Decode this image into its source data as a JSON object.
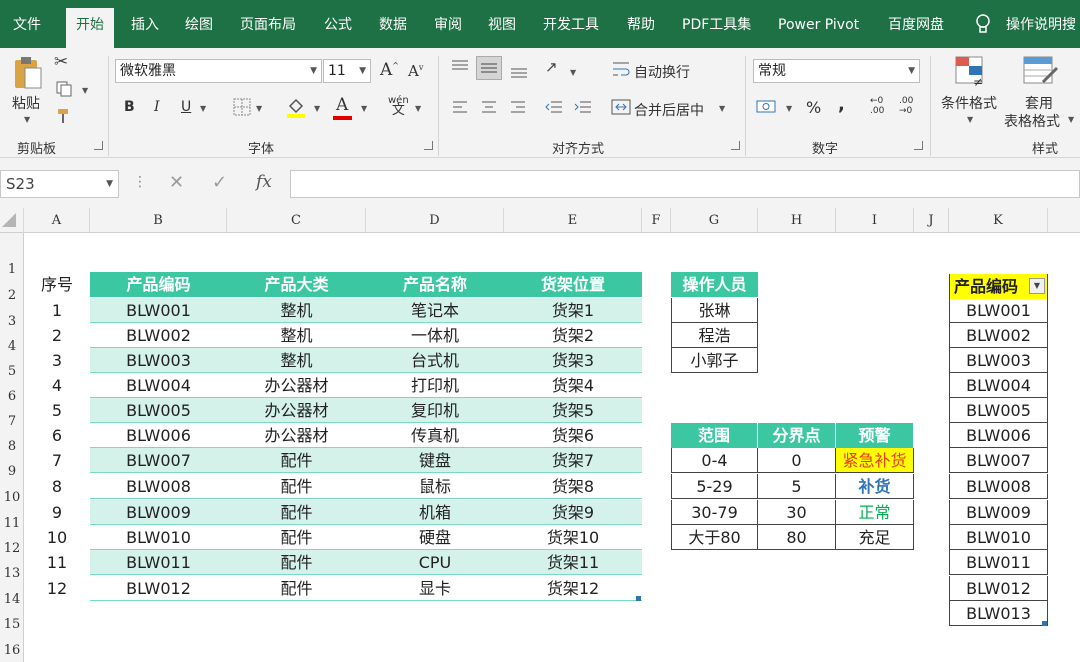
{
  "tabs": [
    "文件",
    "开始",
    "插入",
    "绘图",
    "页面布局",
    "公式",
    "数据",
    "审阅",
    "视图",
    "开发工具",
    "帮助",
    "PDF工具集",
    "Power Pivot",
    "百度网盘",
    "操作说明搜"
  ],
  "ribbon": {
    "paste_label": "粘贴",
    "clipboard_label": "剪贴板",
    "font_name": "微软雅黑",
    "font_size": "11",
    "font_label": "字体",
    "bold": "B",
    "italic": "I",
    "underline": "U",
    "wrap_text": "自动换行",
    "merge_center": "合并后居中",
    "align_label": "对齐方式",
    "number_format": "常规",
    "number_label": "数字",
    "cond_format": "条件格式",
    "table_format_1": "套用",
    "table_format_2": "表格格式",
    "style_label": "样式",
    "grow_font": "A",
    "shrink_font": "A",
    "font_color": "A",
    "percent": "%",
    "comma": ","
  },
  "formula_bar": {
    "name_box": "S23",
    "fx": "fx",
    "formula": ""
  },
  "columns": [
    "A",
    "B",
    "C",
    "D",
    "E",
    "F",
    "G",
    "H",
    "I",
    "J",
    "K"
  ],
  "rows": [
    "1",
    "2",
    "3",
    "4",
    "5",
    "6",
    "7",
    "8",
    "9",
    "10",
    "11",
    "12",
    "13",
    "14",
    "15",
    "16"
  ],
  "main_table": {
    "seq_header": "序号",
    "headers": [
      "产品编码",
      "产品大类",
      "产品名称",
      "货架位置"
    ],
    "rows": [
      [
        "1",
        "BLW001",
        "整机",
        "笔记本",
        "货架1"
      ],
      [
        "2",
        "BLW002",
        "整机",
        "一体机",
        "货架2"
      ],
      [
        "3",
        "BLW003",
        "整机",
        "台式机",
        "货架3"
      ],
      [
        "4",
        "BLW004",
        "办公器材",
        "打印机",
        "货架4"
      ],
      [
        "5",
        "BLW005",
        "办公器材",
        "复印机",
        "货架5"
      ],
      [
        "6",
        "BLW006",
        "办公器材",
        "传真机",
        "货架6"
      ],
      [
        "7",
        "BLW007",
        "配件",
        "键盘",
        "货架7"
      ],
      [
        "8",
        "BLW008",
        "配件",
        "鼠标",
        "货架8"
      ],
      [
        "9",
        "BLW009",
        "配件",
        "机箱",
        "货架9"
      ],
      [
        "10",
        "BLW010",
        "配件",
        "硬盘",
        "货架10"
      ],
      [
        "11",
        "BLW011",
        "配件",
        "CPU",
        "货架11"
      ],
      [
        "12",
        "BLW012",
        "配件",
        "显卡",
        "货架12"
      ]
    ]
  },
  "operators": {
    "header": "操作人员",
    "names": [
      "张琳",
      "程浩",
      "小郭子"
    ]
  },
  "warning_table": {
    "headers": [
      "范围",
      "分界点",
      "预警"
    ],
    "rows": [
      [
        "0-4",
        "0",
        "紧急补货"
      ],
      [
        "5-29",
        "5",
        "补货"
      ],
      [
        "30-79",
        "30",
        "正常"
      ],
      [
        "大于80",
        "80",
        "充足"
      ]
    ]
  },
  "code_list": {
    "header": "产品编码",
    "codes": [
      "BLW001",
      "BLW002",
      "BLW003",
      "BLW004",
      "BLW005",
      "BLW006",
      "BLW007",
      "BLW008",
      "BLW009",
      "BLW010",
      "BLW011",
      "BLW012",
      "BLW013"
    ]
  },
  "colors": {
    "ribbon_green": "#1e7145",
    "header_teal": "#3cc7a3",
    "zebra": "#d4f2ea",
    "yellow": "#ffff00",
    "urgent_red": "#e53b22",
    "restock_blue": "#2f75b5",
    "normal_green": "#00b050"
  }
}
